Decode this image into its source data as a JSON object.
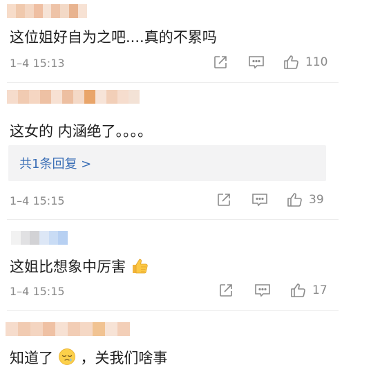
{
  "comments": [
    {
      "text": "这位姐好自为之吧....真的不累吗",
      "time": "1–4 15:13",
      "likes": "110",
      "name_colors": [
        "#f7dcc9",
        "#f0c9ad",
        "#f4d7c3",
        "#efbfa2",
        "#f6e3d6",
        "#eec3a7",
        "#f3d9c6",
        "#e8b38f",
        "#f7e2d4"
      ]
    },
    {
      "text": "这女的 内涵绝了。。。。",
      "time": "1–4 15:15",
      "likes": "39",
      "reply_label": "共1条回复 >",
      "name_colors": [
        "#f6dccc",
        "#f1cbb2",
        "#f5d6c2",
        "#eec1a4",
        "#f7e1d3",
        "#edbfa1",
        "#f4d9c7",
        "#e9a56a",
        "#f7e4d8",
        "#f2cfb8",
        "#f6ddce",
        "#f3e2d6"
      ]
    },
    {
      "text": "这姐比想象中厉害",
      "time": "1–4 15:15",
      "likes": "17",
      "emoji": "thumbs-up-emoji",
      "name_colors": [
        "#f2f2f2",
        "#e1e1e3",
        "#d2d2d5",
        "#dde7f6",
        "#c9dcf5",
        "#b7d0f2"
      ]
    },
    {
      "text_before": "知道了",
      "text_after": "，关我们啥事",
      "emoji": "sleepy-face-emoji",
      "name_colors": [
        "#f6dccc",
        "#f1cbb2",
        "#f4d5c1",
        "#efc1a4",
        "#f7e1d3",
        "#f2cdb5",
        "#f5d8c5",
        "#f1c392",
        "#f7e3d6",
        "#f3cfb8"
      ]
    }
  ],
  "icons": {
    "forward": "share-icon",
    "comment": "comment-icon",
    "like": "thumbs-up-icon"
  },
  "colors": {
    "text": "#1e1e1e",
    "meta": "#8a8a8a",
    "link": "#3b6fb6",
    "reply_bg": "#f3f3f4"
  }
}
